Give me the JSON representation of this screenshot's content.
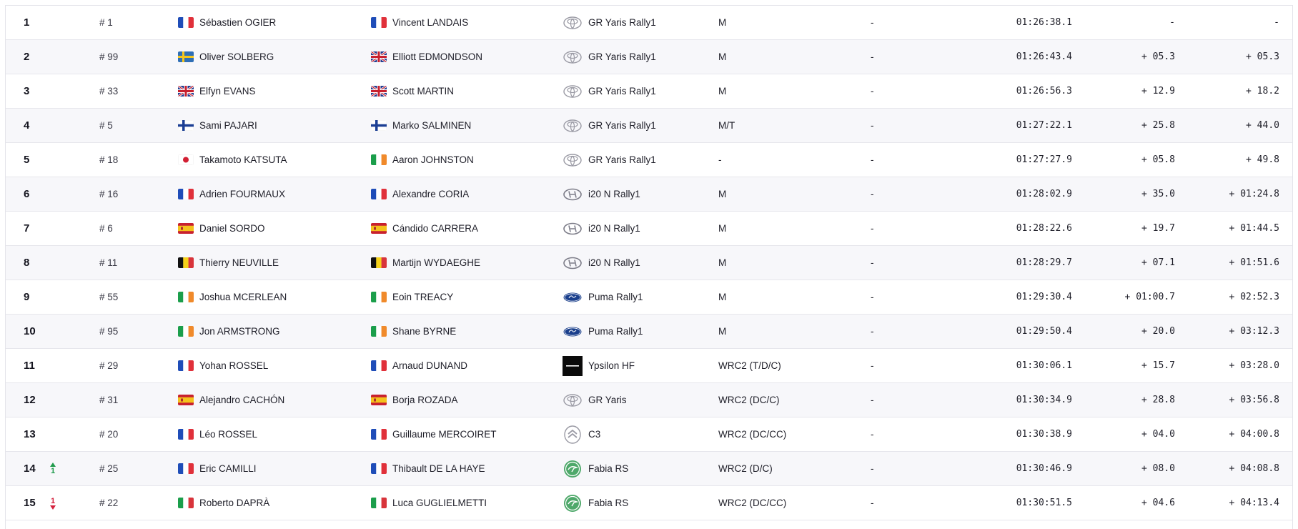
{
  "rows": [
    {
      "pos": "1",
      "change": null,
      "num": "# 1",
      "driver": {
        "flag": "fr",
        "name": "Sébastien OGIER"
      },
      "codriver": {
        "flag": "fr",
        "name": "Vincent LANDAIS"
      },
      "brand": "toyota",
      "car": "GR Yaris Rally1",
      "cls": "M",
      "pen": "-",
      "time": "01:26:38.1",
      "diff_prev": "-",
      "diff_first": "-"
    },
    {
      "pos": "2",
      "change": null,
      "num": "# 99",
      "driver": {
        "flag": "se",
        "name": "Oliver SOLBERG"
      },
      "codriver": {
        "flag": "gb",
        "name": "Elliott EDMONDSON"
      },
      "brand": "toyota",
      "car": "GR Yaris Rally1",
      "cls": "M",
      "pen": "-",
      "time": "01:26:43.4",
      "diff_prev": "+ 05.3",
      "diff_first": "+ 05.3"
    },
    {
      "pos": "3",
      "change": null,
      "num": "# 33",
      "driver": {
        "flag": "gb",
        "name": "Elfyn EVANS"
      },
      "codriver": {
        "flag": "gb",
        "name": "Scott MARTIN"
      },
      "brand": "toyota",
      "car": "GR Yaris Rally1",
      "cls": "M",
      "pen": "-",
      "time": "01:26:56.3",
      "diff_prev": "+ 12.9",
      "diff_first": "+ 18.2"
    },
    {
      "pos": "4",
      "change": null,
      "num": "# 5",
      "driver": {
        "flag": "fi",
        "name": "Sami PAJARI"
      },
      "codriver": {
        "flag": "fi",
        "name": "Marko SALMINEN"
      },
      "brand": "toyota",
      "car": "GR Yaris Rally1",
      "cls": "M/T",
      "pen": "-",
      "time": "01:27:22.1",
      "diff_prev": "+ 25.8",
      "diff_first": "+ 44.0"
    },
    {
      "pos": "5",
      "change": null,
      "num": "# 18",
      "driver": {
        "flag": "jp",
        "name": "Takamoto KATSUTA"
      },
      "codriver": {
        "flag": "ie",
        "name": "Aaron JOHNSTON"
      },
      "brand": "toyota",
      "car": "GR Yaris Rally1",
      "cls": "-",
      "pen": "-",
      "time": "01:27:27.9",
      "diff_prev": "+ 05.8",
      "diff_first": "+ 49.8"
    },
    {
      "pos": "6",
      "change": null,
      "num": "# 16",
      "driver": {
        "flag": "fr",
        "name": "Adrien FOURMAUX"
      },
      "codriver": {
        "flag": "fr",
        "name": "Alexandre CORIA"
      },
      "brand": "hyundai",
      "car": "i20 N Rally1",
      "cls": "M",
      "pen": "-",
      "time": "01:28:02.9",
      "diff_prev": "+ 35.0",
      "diff_first": "+ 01:24.8"
    },
    {
      "pos": "7",
      "change": null,
      "num": "# 6",
      "driver": {
        "flag": "es",
        "name": "Daniel SORDO"
      },
      "codriver": {
        "flag": "es",
        "name": "Cándido CARRERA"
      },
      "brand": "hyundai",
      "car": "i20 N Rally1",
      "cls": "M",
      "pen": "-",
      "time": "01:28:22.6",
      "diff_prev": "+ 19.7",
      "diff_first": "+ 01:44.5"
    },
    {
      "pos": "8",
      "change": null,
      "num": "# 11",
      "driver": {
        "flag": "be",
        "name": "Thierry NEUVILLE"
      },
      "codriver": {
        "flag": "be",
        "name": "Martijn WYDAEGHE"
      },
      "brand": "hyundai",
      "car": "i20 N Rally1",
      "cls": "M",
      "pen": "-",
      "time": "01:28:29.7",
      "diff_prev": "+ 07.1",
      "diff_first": "+ 01:51.6"
    },
    {
      "pos": "9",
      "change": null,
      "num": "# 55",
      "driver": {
        "flag": "ie",
        "name": "Joshua MCERLEAN"
      },
      "codriver": {
        "flag": "ie",
        "name": "Eoin TREACY"
      },
      "brand": "ford",
      "car": "Puma Rally1",
      "cls": "M",
      "pen": "-",
      "time": "01:29:30.4",
      "diff_prev": "+ 01:00.7",
      "diff_first": "+ 02:52.3"
    },
    {
      "pos": "10",
      "change": null,
      "num": "# 95",
      "driver": {
        "flag": "ie",
        "name": "Jon ARMSTRONG"
      },
      "codriver": {
        "flag": "ie",
        "name": "Shane BYRNE"
      },
      "brand": "ford",
      "car": "Puma Rally1",
      "cls": "M",
      "pen": "-",
      "time": "01:29:50.4",
      "diff_prev": "+ 20.0",
      "diff_first": "+ 03:12.3"
    },
    {
      "pos": "11",
      "change": null,
      "num": "# 29",
      "driver": {
        "flag": "fr",
        "name": "Yohan ROSSEL"
      },
      "codriver": {
        "flag": "fr",
        "name": "Arnaud DUNAND"
      },
      "brand": "lancia",
      "car": "Ypsilon HF",
      "cls": "WRC2 (T/D/C)",
      "pen": "-",
      "time": "01:30:06.1",
      "diff_prev": "+ 15.7",
      "diff_first": "+ 03:28.0"
    },
    {
      "pos": "12",
      "change": null,
      "num": "# 31",
      "driver": {
        "flag": "es",
        "name": "Alejandro CACHÓN"
      },
      "codriver": {
        "flag": "es",
        "name": "Borja ROZADA"
      },
      "brand": "toyota",
      "car": "GR Yaris",
      "cls": "WRC2 (DC/C)",
      "pen": "-",
      "time": "01:30:34.9",
      "diff_prev": "+ 28.8",
      "diff_first": "+ 03:56.8"
    },
    {
      "pos": "13",
      "change": null,
      "num": "# 20",
      "driver": {
        "flag": "fr",
        "name": "Léo ROSSEL"
      },
      "codriver": {
        "flag": "fr",
        "name": "Guillaume MERCOIRET"
      },
      "brand": "citroen",
      "car": "C3",
      "cls": "WRC2 (DC/CC)",
      "pen": "-",
      "time": "01:30:38.9",
      "diff_prev": "+ 04.0",
      "diff_first": "+ 04:00.8"
    },
    {
      "pos": "14",
      "change": {
        "dir": "up",
        "value": "1"
      },
      "num": "# 25",
      "driver": {
        "flag": "fr",
        "name": "Eric CAMILLI"
      },
      "codriver": {
        "flag": "fr",
        "name": "Thibault DE LA HAYE"
      },
      "brand": "skoda",
      "car": "Fabia RS",
      "cls": "WRC2 (D/C)",
      "pen": "-",
      "time": "01:30:46.9",
      "diff_prev": "+ 08.0",
      "diff_first": "+ 04:08.8"
    },
    {
      "pos": "15",
      "change": {
        "dir": "down",
        "value": "1"
      },
      "num": "# 22",
      "driver": {
        "flag": "it",
        "name": "Roberto DAPRÀ"
      },
      "codriver": {
        "flag": "it",
        "name": "Luca GUGLIELMETTI"
      },
      "brand": "skoda",
      "car": "Fabia RS",
      "cls": "WRC2 (DC/CC)",
      "pen": "-",
      "time": "01:30:51.5",
      "diff_prev": "+ 04.6",
      "diff_first": "+ 04:13.4"
    }
  ],
  "flag_colors": {
    "fr": [
      "#1f4db8",
      "#ffffff",
      "#e0303a"
    ],
    "it": [
      "#1b9e4b",
      "#ffffff",
      "#d8343b"
    ],
    "ie": [
      "#1b9e4b",
      "#ffffff",
      "#f08a2b"
    ],
    "be": [
      "#111111",
      "#f6d21a",
      "#d8343b"
    ],
    "es": [
      "#c8202f",
      "#f4c21c",
      "#c8202f"
    ],
    "se": "#2f6fb5",
    "fi": "#ffffff",
    "jp": "#ffffff",
    "gb": "#213a8f"
  }
}
